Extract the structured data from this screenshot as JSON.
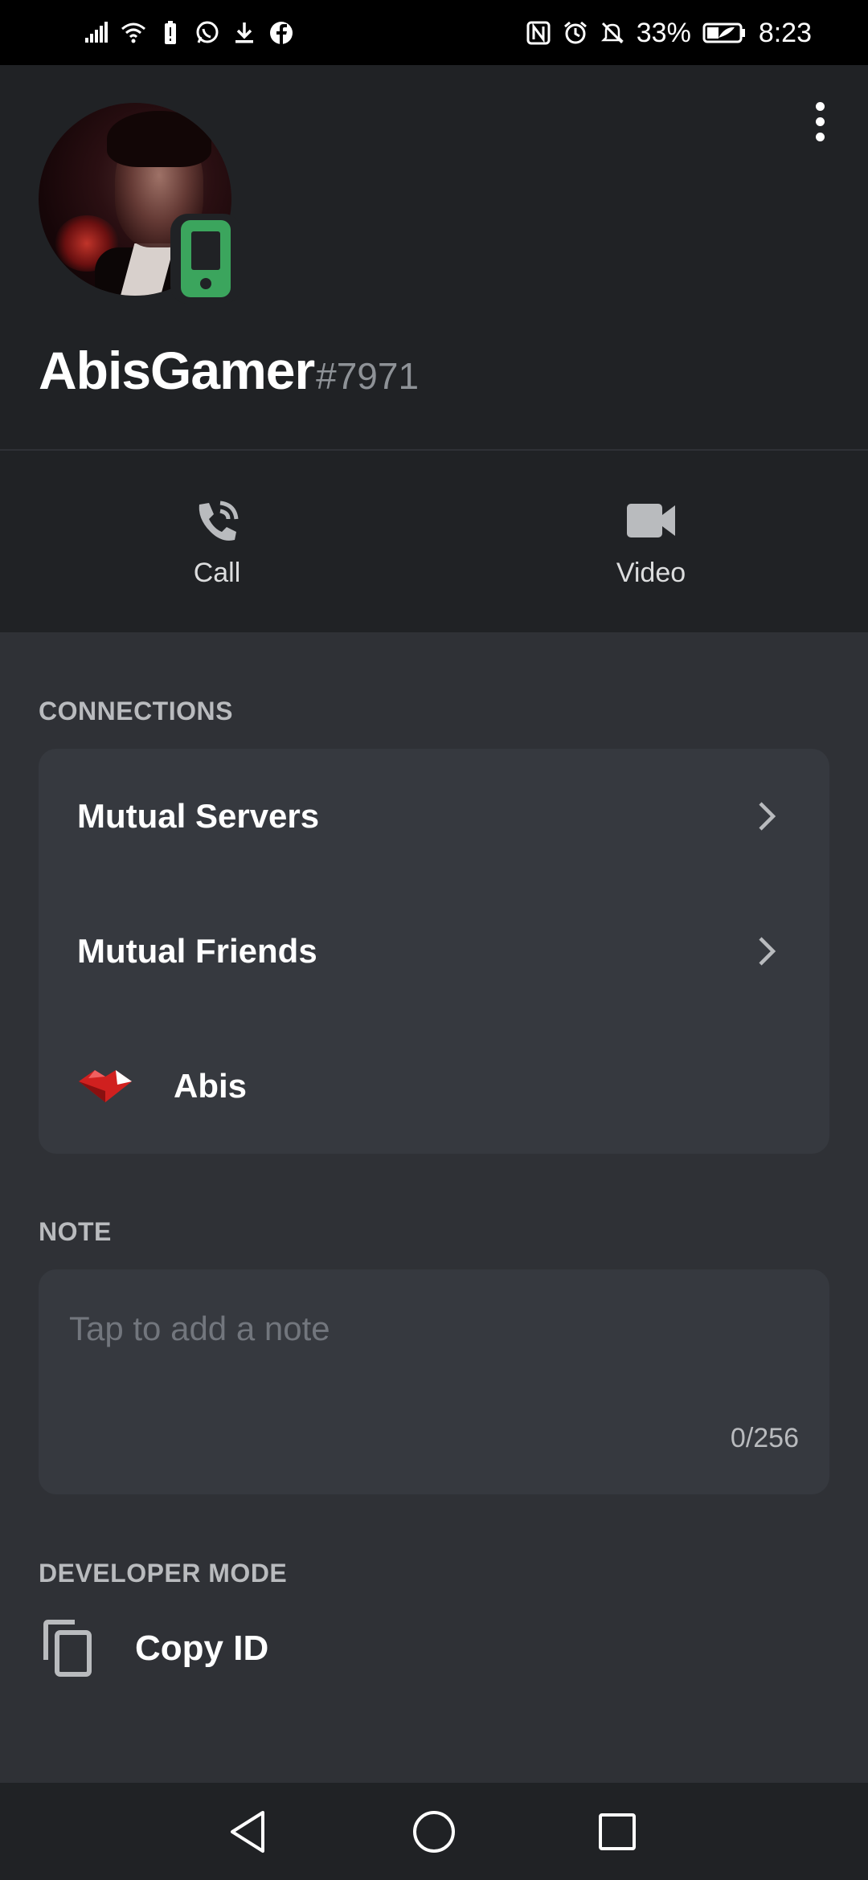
{
  "status_bar": {
    "battery_percent": "33%",
    "time": "8:23",
    "left_icons": [
      "signal-icon",
      "wifi-icon",
      "battery-alert-icon",
      "whatsapp-icon",
      "download-icon",
      "facebook-icon"
    ],
    "right_icons": [
      "nfc-icon",
      "alarm-icon",
      "mute-icon",
      "battery-icon"
    ]
  },
  "profile": {
    "username": "AbisGamer",
    "discriminator": "#7971",
    "status": "mobile"
  },
  "actions": {
    "call_label": "Call",
    "video_label": "Video"
  },
  "connections": {
    "title": "CONNECTIONS",
    "items": [
      {
        "label": "Mutual Servers"
      },
      {
        "label": "Mutual Friends"
      },
      {
        "label": "Abis",
        "icon": "connection-service-icon"
      }
    ]
  },
  "note": {
    "title": "NOTE",
    "placeholder": "Tap to add a note",
    "counter": "0/256"
  },
  "developer_mode": {
    "title": "DEVELOPER MODE",
    "copy_id_label": "Copy ID"
  },
  "colors": {
    "background": "#2f3136",
    "header": "#202225",
    "card": "#36393f",
    "online_mobile": "#3ba55d",
    "muted_text": "#b9bbbe"
  }
}
